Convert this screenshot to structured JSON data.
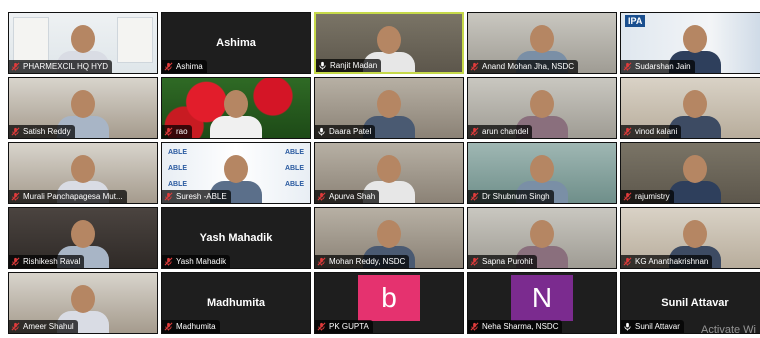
{
  "participants": [
    {
      "name": "PHARMEXCIL HQ HYD",
      "type": "video",
      "scene": "banner",
      "muted": true
    },
    {
      "name": "Ashima",
      "type": "name",
      "center": "Ashima",
      "muted": true
    },
    {
      "name": "Ranjit Madan",
      "type": "video",
      "scene": "office",
      "active": true,
      "muted": false
    },
    {
      "name": "Anand Mohan Jha, NSDC",
      "type": "video",
      "scene": "wall",
      "muted": true
    },
    {
      "name": "Sudarshan Jain",
      "type": "video",
      "scene": "ipa",
      "logo": "IPA",
      "muted": true
    },
    {
      "name": "Satish Reddy",
      "type": "video",
      "scene": "room",
      "muted": true
    },
    {
      "name": "rao",
      "type": "video",
      "scene": "flowers",
      "muted": true
    },
    {
      "name": "Daara Patel",
      "type": "video",
      "scene": "office2",
      "muted": false
    },
    {
      "name": "arun chandel",
      "type": "video",
      "scene": "wall",
      "muted": true
    },
    {
      "name": "vinod kalani",
      "type": "video",
      "scene": "frames",
      "muted": true
    },
    {
      "name": "Murali Panchapagesa Mut...",
      "type": "video",
      "scene": "room",
      "muted": true
    },
    {
      "name": "Suresh -ABLE",
      "type": "video",
      "scene": "able",
      "muted": true
    },
    {
      "name": "Apurva Shah",
      "type": "video",
      "scene": "office2",
      "muted": true
    },
    {
      "name": "Dr Shubnum Singh",
      "type": "video",
      "scene": "teal",
      "muted": true
    },
    {
      "name": "rajumistry",
      "type": "video",
      "scene": "office",
      "muted": true
    },
    {
      "name": "Rishikesh Raval",
      "type": "video",
      "scene": "dark",
      "muted": true
    },
    {
      "name": "Yash Mahadik",
      "type": "name",
      "center": "Yash Mahadik",
      "muted": true
    },
    {
      "name": "Mohan Reddy, NSDC",
      "type": "video",
      "scene": "office2",
      "muted": true
    },
    {
      "name": "Sapna Purohit",
      "type": "video",
      "scene": "wall",
      "muted": true
    },
    {
      "name": "KG Ananthakrishnan",
      "type": "video",
      "scene": "frames",
      "muted": true
    },
    {
      "name": "Ameer Shahul",
      "type": "video",
      "scene": "room",
      "muted": true
    },
    {
      "name": "Madhumita",
      "type": "name",
      "center": "Madhumita",
      "muted": true
    },
    {
      "name": "PK GUPTA",
      "type": "avatar",
      "letter": "b",
      "color": "#e5326f",
      "muted": true
    },
    {
      "name": "Neha Sharma, NSDC",
      "type": "avatar",
      "letter": "N",
      "color": "#7b2b8f",
      "muted": true
    },
    {
      "name": "Sunil Attavar",
      "type": "name",
      "center": "Sunil Attavar",
      "muted": false
    }
  ],
  "able_logo": "ABLE",
  "watermark": "Activate Wi",
  "colors": {
    "active_border": "#c6d94a",
    "muted_mic": "#e03b3b"
  }
}
